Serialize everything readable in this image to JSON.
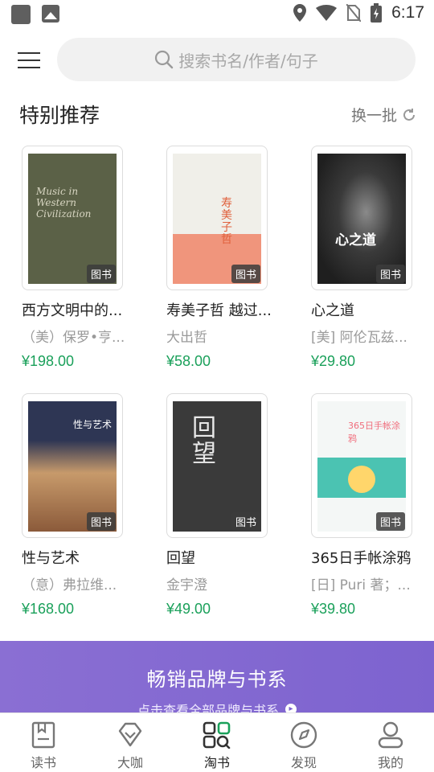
{
  "status_bar": {
    "time": "6:17"
  },
  "header": {
    "search_placeholder": "搜索书名/作者/句子"
  },
  "section": {
    "title": "特别推荐",
    "refresh_label": "换一批"
  },
  "books": [
    {
      "title": "西方文明中的...",
      "author": "（美）保罗•亨...",
      "price": "¥198.00",
      "tag": "图书",
      "cover_color": "#5b6147",
      "cover_text": "Music in Western Civilization"
    },
    {
      "title": "寿美子哲 越过...",
      "author": "大出哲",
      "price": "¥58.00",
      "tag": "图书",
      "cover_color": "#f0efe9",
      "cover_text": ""
    },
    {
      "title": "心之道",
      "author": "[美] 阿伦瓦兹...",
      "price": "¥29.80",
      "tag": "图书",
      "cover_color": "#2b2b2b",
      "cover_text": "心之道"
    },
    {
      "title": "性与艺术",
      "author": "（意）弗拉维...",
      "price": "¥168.00",
      "tag": "图书",
      "cover_color": "#3b4362",
      "cover_text": "性与艺术"
    },
    {
      "title": "回望",
      "author": "金宇澄",
      "price": "¥49.00",
      "tag": "图书",
      "cover_color": "#3a3a3a",
      "cover_text": "回望"
    },
    {
      "title": "365日手帐涂鸦",
      "author": "[日] Puri 著；...",
      "price": "¥39.80",
      "tag": "图书",
      "cover_color": "#f4f7f6",
      "cover_text": "365日手帐涂鸦"
    }
  ],
  "banner": {
    "title": "畅销品牌与书系",
    "subtitle": "点击查看全部品牌与书系"
  },
  "bottom_nav": {
    "items": [
      {
        "label": "读书",
        "icon": "book-icon"
      },
      {
        "label": "大咖",
        "icon": "diamond-icon"
      },
      {
        "label": "淘书",
        "icon": "shop-grid-icon"
      },
      {
        "label": "发现",
        "icon": "compass-icon"
      },
      {
        "label": "我的",
        "icon": "profile-icon"
      }
    ],
    "active_index": 2
  },
  "colors": {
    "price": "#1aa05a",
    "banner": "#8a6fd3",
    "accent_green": "#1aa05a"
  }
}
